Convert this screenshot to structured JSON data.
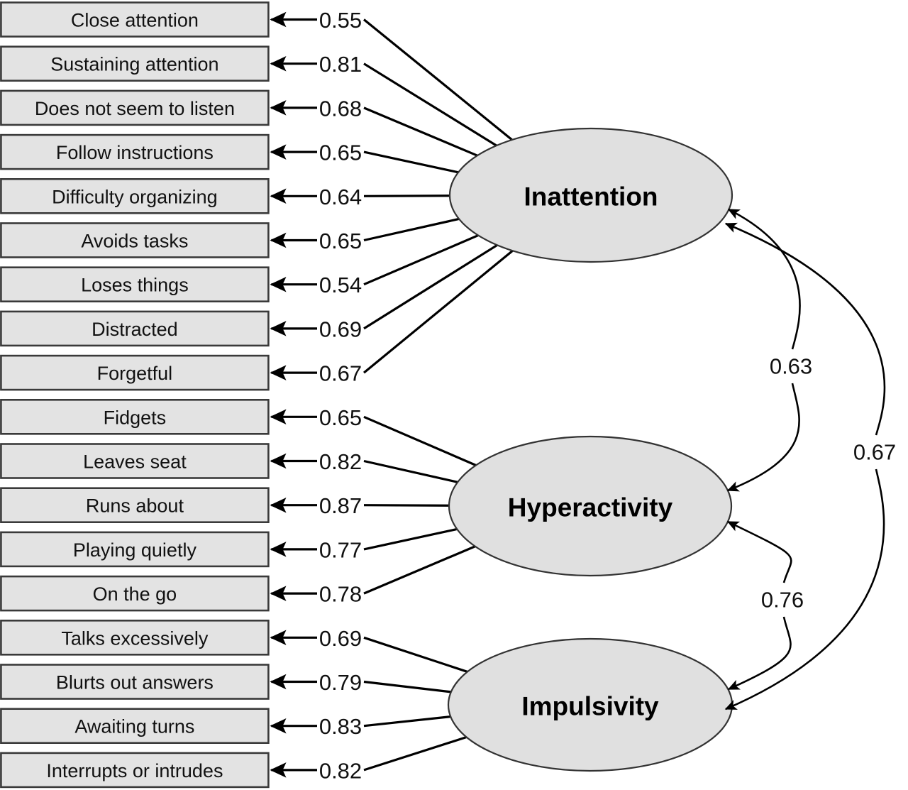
{
  "figure": {
    "type": "sem-path-diagram",
    "title": "ADHD three-factor confirmatory factor analysis path diagram",
    "colors": {
      "indicator_fill": "#e3e3e3",
      "indicator_stroke": "#3a3a3a",
      "latent_fill": "#e0e0e0",
      "latent_stroke": "#333333",
      "path_stroke": "#000000",
      "background": "#ffffff"
    }
  },
  "chart_data": {
    "type": "diagram",
    "title": "ADHD three-factor confirmatory factor analysis path diagram",
    "factors": [
      {
        "id": "inattention",
        "label": "Inattention",
        "indicators": [
          {
            "label": "Close attention",
            "loading": "0.55"
          },
          {
            "label": "Sustaining attention",
            "loading": "0.81"
          },
          {
            "label": "Does not seem to listen",
            "loading": "0.68"
          },
          {
            "label": "Follow instructions",
            "loading": "0.65"
          },
          {
            "label": "Difficulty organizing",
            "loading": "0.64"
          },
          {
            "label": "Avoids tasks",
            "loading": "0.65"
          },
          {
            "label": "Loses things",
            "loading": "0.54"
          },
          {
            "label": "Distracted",
            "loading": "0.69"
          },
          {
            "label": "Forgetful",
            "loading": "0.67"
          }
        ]
      },
      {
        "id": "hyperactivity",
        "label": "Hyperactivity",
        "indicators": [
          {
            "label": "Fidgets",
            "loading": "0.65"
          },
          {
            "label": "Leaves seat",
            "loading": "0.82"
          },
          {
            "label": "Runs about",
            "loading": "0.87"
          },
          {
            "label": "Playing quietly",
            "loading": "0.77"
          },
          {
            "label": "On the go",
            "loading": "0.78"
          }
        ]
      },
      {
        "id": "impulsivity",
        "label": "Impulsivity",
        "indicators": [
          {
            "label": "Talks excessively",
            "loading": "0.69"
          },
          {
            "label": "Blurts out answers",
            "loading": "0.79"
          },
          {
            "label": "Awaiting turns",
            "loading": "0.83"
          },
          {
            "label": "Interrupts or intrudes",
            "loading": "0.82"
          }
        ]
      }
    ],
    "correlations": [
      {
        "from": "inattention",
        "to": "hyperactivity",
        "value": "0.63"
      },
      {
        "from": "hyperactivity",
        "to": "impulsivity",
        "value": "0.76"
      },
      {
        "from": "inattention",
        "to": "impulsivity",
        "value": "0.67"
      }
    ]
  }
}
